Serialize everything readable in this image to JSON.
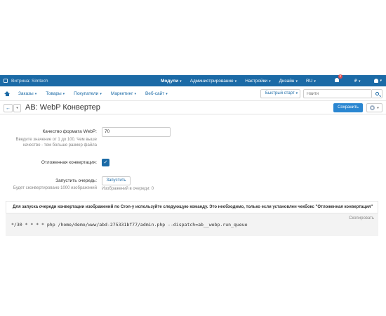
{
  "topbar": {
    "store": "Витрина: Simtech",
    "menu": [
      "Модули",
      "Администрирование",
      "Настройки",
      "Дизайн",
      "RU",
      "₽"
    ],
    "notifications_count": "2"
  },
  "nav": {
    "items": [
      "Заказы",
      "Товары",
      "Покупатели",
      "Маркетинг",
      "Веб-сайт"
    ],
    "quick_start": "Быстрый старт",
    "search_placeholder": "Найти"
  },
  "page": {
    "title": "AB: WebP Конвертер",
    "save": "Сохранить"
  },
  "form": {
    "quality_label": "Качество формата WebP:",
    "quality_hint": "Введите значение от 1 до 100. Чем выше качество - тем больше размер файла",
    "quality_value": "70",
    "deferred_label": "Отложенная конвертация:",
    "run_label": "Запустить очередь:",
    "run_hint": "Будет сконвертировано 1000 изображений",
    "run_button": "Запустить",
    "queue_status": "Изображений в очереди: 0"
  },
  "cron": {
    "heading": "Для запуска очереди конвертации изображений по Cron-у используйте следующую команду. Это необходимо, только если установлен чекбокс \"Отложенная конвертация\"",
    "copy": "Скопировать",
    "command": "*/30 * * * * php /home/demo/www/abd-275331bf77/admin.php --dispatch=ab__webp.run_queue"
  }
}
